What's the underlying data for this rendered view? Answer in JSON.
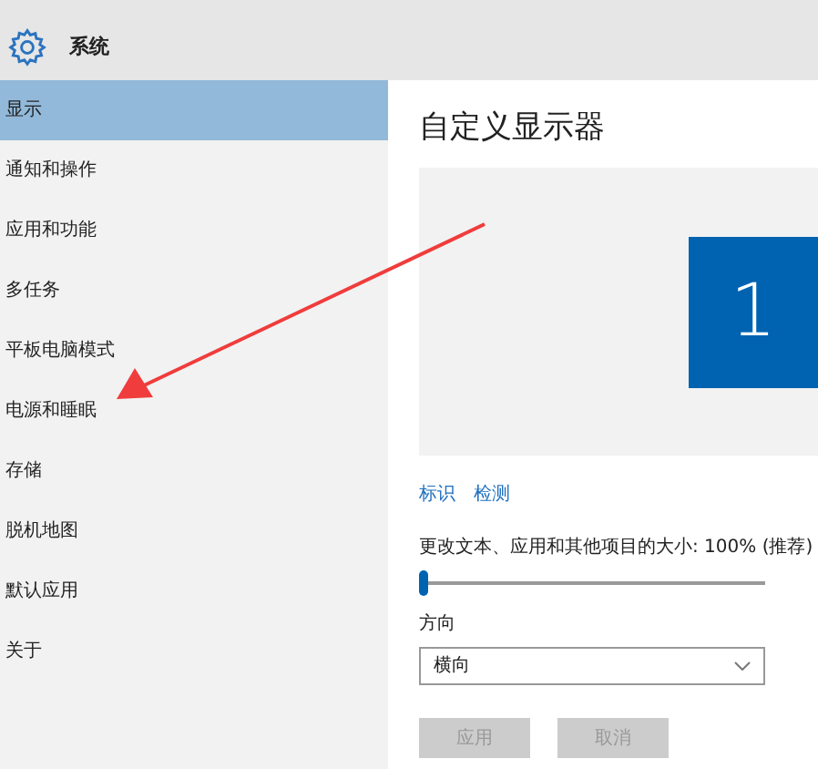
{
  "header": {
    "title": "系统"
  },
  "sidebar": {
    "items": [
      {
        "label": "显示",
        "selected": true
      },
      {
        "label": "通知和操作",
        "selected": false
      },
      {
        "label": "应用和功能",
        "selected": false
      },
      {
        "label": "多任务",
        "selected": false
      },
      {
        "label": "平板电脑模式",
        "selected": false
      },
      {
        "label": "电源和睡眠",
        "selected": false
      },
      {
        "label": "存储",
        "selected": false
      },
      {
        "label": "脱机地图",
        "selected": false
      },
      {
        "label": "默认应用",
        "selected": false
      },
      {
        "label": "关于",
        "selected": false
      }
    ]
  },
  "main": {
    "title": "自定义显示器",
    "monitor": {
      "number": "1"
    },
    "links": [
      "标识",
      "检测"
    ],
    "scale": {
      "label": "更改文本、应用和其他项目的大小: 100% (推荐)",
      "level": 0
    },
    "orientation": {
      "label": "方向",
      "value": "横向"
    },
    "buttons": [
      {
        "label": "应用",
        "disabled": true
      },
      {
        "label": "取消",
        "disabled": true
      }
    ]
  }
}
